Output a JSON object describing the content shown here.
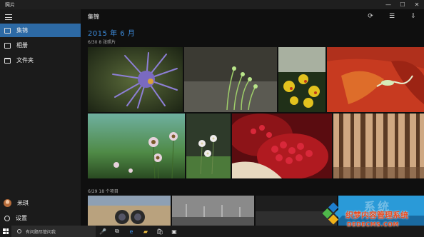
{
  "window": {
    "title": "照片",
    "minimize": "—",
    "maximize": "☐",
    "close": "✕"
  },
  "sidebar": {
    "items": [
      {
        "label": "集锦",
        "icon": "collection-icon",
        "active": true
      },
      {
        "label": "相册",
        "icon": "album-icon",
        "active": false
      },
      {
        "label": "文件夹",
        "icon": "folder-icon",
        "active": false
      }
    ],
    "user": {
      "name": "米琪"
    },
    "settings": {
      "label": "设置"
    }
  },
  "main": {
    "heading": "集锦",
    "month": "2015 年 6 月",
    "groups": [
      {
        "label": "6/30 8 张照片"
      },
      {
        "label": "6/29 18 个项目"
      }
    ],
    "toolbar": {
      "refresh": "⟳",
      "select": "☰",
      "import": "⇩"
    }
  },
  "taskbar": {
    "search_placeholder": "有问题尽管问我",
    "icons": [
      "microphone-icon",
      "task-view-icon",
      "edge-icon",
      "file-explorer-icon",
      "store-icon",
      "photos-icon"
    ]
  },
  "watermark": {
    "brand": "织梦内容管理系统",
    "url": "DEDECMS.COM",
    "ghost": "系统"
  },
  "colors": {
    "accent": "#2d6aa5",
    "month_blue": "#3d8ee0",
    "watermark": "#e84a1e"
  }
}
